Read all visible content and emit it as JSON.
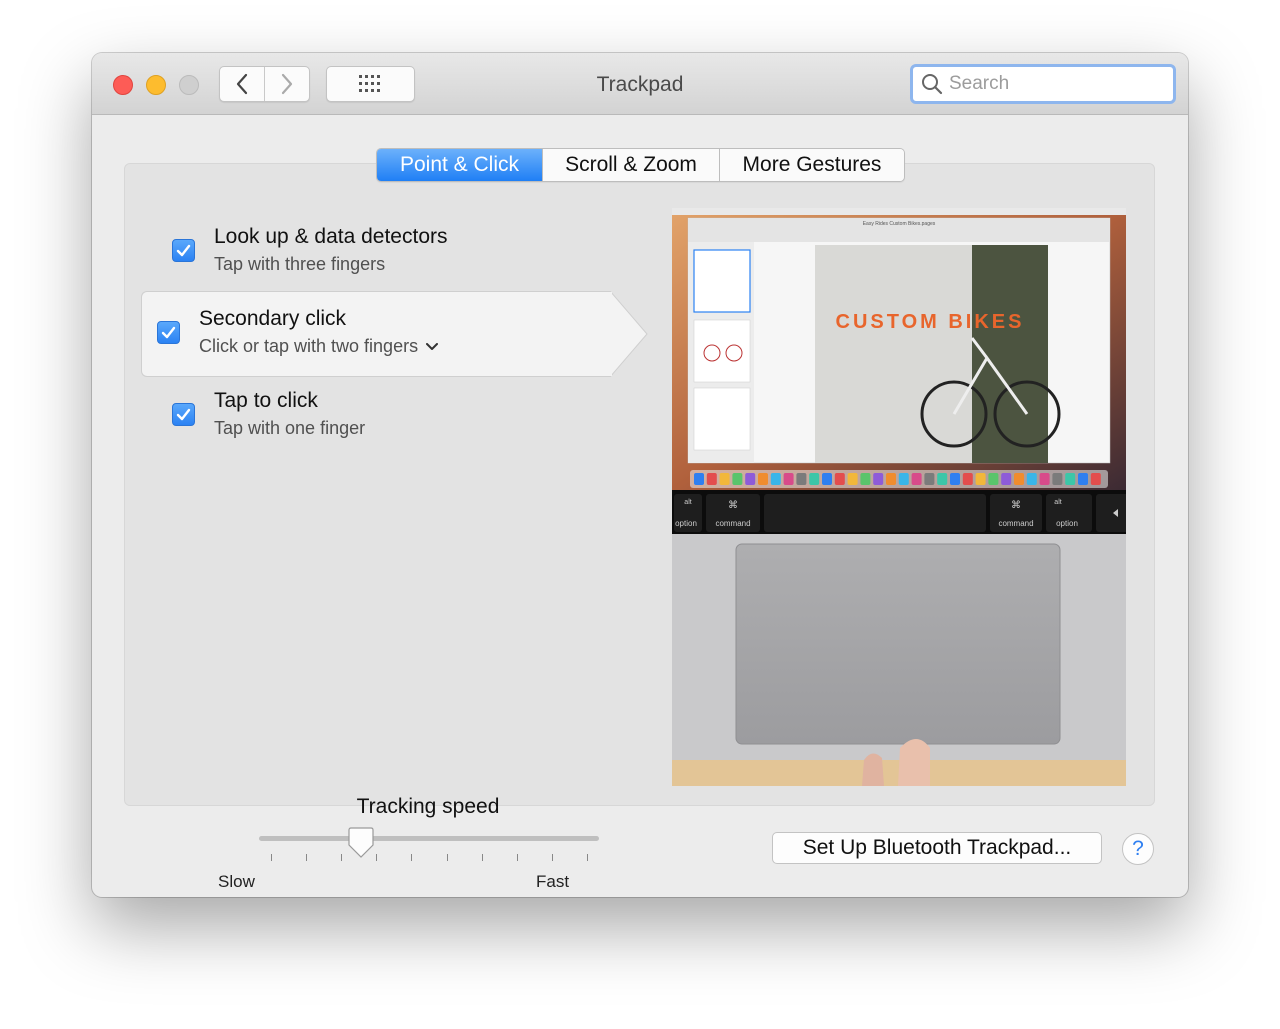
{
  "window": {
    "title": "Trackpad",
    "search": {
      "placeholder": "Search"
    }
  },
  "tabs": [
    {
      "label": "Point & Click",
      "selected": true
    },
    {
      "label": "Scroll & Zoom",
      "selected": false
    },
    {
      "label": "More Gestures",
      "selected": false
    }
  ],
  "options": [
    {
      "title": "Look up & data detectors",
      "subtitle": "Tap with three fingers",
      "checked": true
    },
    {
      "title": "Secondary click",
      "subtitle": "Click or tap with two fingers",
      "checked": true,
      "selected": true
    },
    {
      "title": "Tap to click",
      "subtitle": "Tap with one finger",
      "checked": true
    }
  ],
  "tracking": {
    "label": "Tracking speed",
    "min_label": "Slow",
    "max_label": "Fast",
    "level": 0.3,
    "ticks": 10
  },
  "preview": {
    "doc_title": "Easy Rides Custom Bikes.pages",
    "headline": "CUSTOM BIKES",
    "keys": {
      "alt": "alt",
      "option": "option",
      "command": "command",
      "cmd_symbol": "⌘"
    }
  },
  "footer": {
    "setup_button": "Set Up Bluetooth Trackpad...",
    "help": "?"
  },
  "colors": {
    "accent": "#2b82f3",
    "close": "#fd5c56",
    "minimize": "#fdbc2e",
    "disabled": "#cfcfcf"
  }
}
